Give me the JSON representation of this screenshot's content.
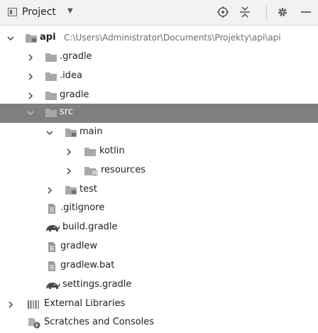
{
  "toolbar": {
    "project_label": "Project",
    "icons": [
      "dropdown-caret-icon",
      "globe-icon",
      "collapse-icon",
      "gear-icon",
      "minimize-icon"
    ]
  },
  "tree": {
    "api": {
      "label": "api",
      "path": "C:\\Users\\Administrator\\Documents\\Projekty\\api\\api"
    },
    "gradle_dot": {
      "label": ".gradle"
    },
    "idea": {
      "label": ".idea"
    },
    "gradle": {
      "label": "gradle"
    },
    "src": {
      "label": "src"
    },
    "main": {
      "label": "main"
    },
    "kotlin": {
      "label": "kotlin"
    },
    "resources": {
      "label": "resources"
    },
    "test": {
      "label": "test"
    },
    "gitignore": {
      "label": ".gitignore"
    },
    "build_gradle": {
      "label": "build.gradle"
    },
    "gradlew": {
      "label": "gradlew"
    },
    "gradlew_bat": {
      "label": "gradlew.bat"
    },
    "settings_gradle": {
      "label": "settings.gradle"
    },
    "external_libraries": {
      "label": "External Libraries"
    },
    "scratches": {
      "label": "Scratches and Consoles"
    }
  },
  "colors": {
    "selection": "#7f7f7f",
    "toolbar_bg": "#f2f2f2",
    "folder": "#a8a8a8"
  }
}
